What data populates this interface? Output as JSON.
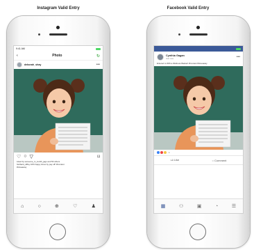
{
  "captions": {
    "instagram": "Instagram Valid Entry",
    "facebook": "Facebook Valid Entry"
  },
  "instagram": {
    "status_time": "9:41 AM",
    "nav_back": "‹",
    "nav_title": "Photo",
    "nav_refresh": "↻",
    "username": "deborah_shay",
    "likes_text": "Liked by someone_in_zenith_jago and 50 others",
    "caption_text": "hubbard_diffey 10% happy times by pay off! #Contest",
    "hashtag_text": "#Giveaway",
    "actions": {
      "like": "♡",
      "comment": "○",
      "share": "▽",
      "bookmark": "⌑"
    },
    "tabs": [
      "⌂",
      "○",
      "⊕",
      "♡",
      "♟"
    ]
  },
  "facebook": {
    "name": "Cynthia Gagan",
    "time": "Just now",
    "description": "Entered to WIN a Wellness Basket! #Contest #Giveaway",
    "reaction_count": "1",
    "like_label": "Like",
    "comment_label": "Comment",
    "tabs": [
      "▦",
      "⚇",
      "▣",
      "◔",
      "☰"
    ]
  }
}
